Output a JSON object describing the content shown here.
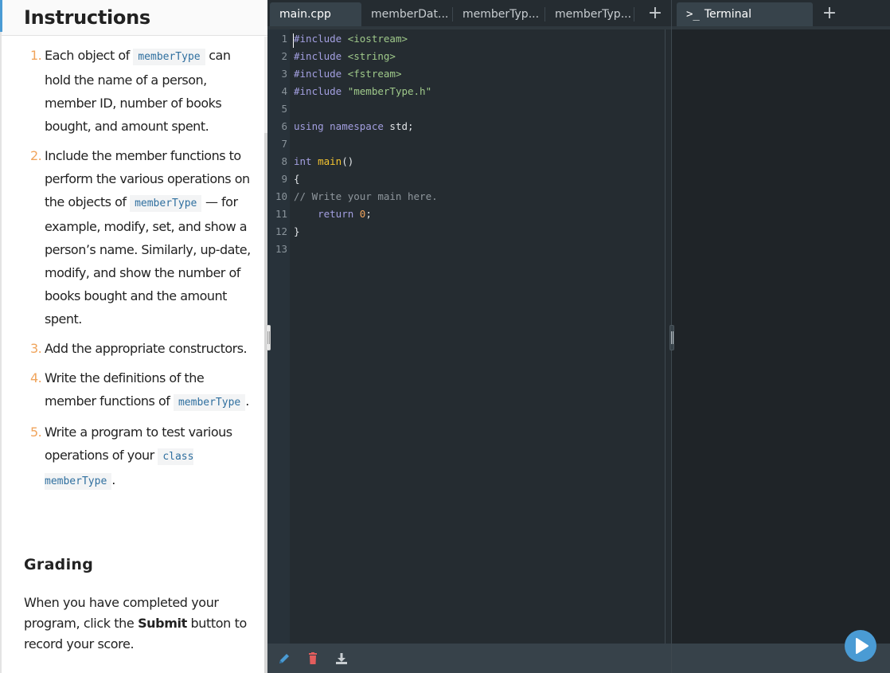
{
  "instructions": {
    "title": "Instructions",
    "items": [
      {
        "num": "1.",
        "before": "Each object of ",
        "code": "memberType",
        "after": " can hold the name of a person, member ID, number of books bought, and amount spent."
      },
      {
        "num": "2.",
        "before": "Include the member functions to perform the various operations on the objects of ",
        "code": "memberType",
        "after": " — for example, modify, set, and show a person’s name. Similarly, up-date, modify, and show the number of books bought and the amount spent."
      },
      {
        "num": "3.",
        "before": "Add the appropriate constructors.",
        "code": "",
        "after": ""
      },
      {
        "num": "4.",
        "before": "Write the definitions of the member functions of ",
        "code": "memberType",
        "after": "."
      },
      {
        "num": "5.",
        "before": "Write a program to test various operations of your ",
        "code": "class memberType",
        "after": "."
      }
    ],
    "grading_title": "Grading",
    "grading_before": "When you have completed your program, click the ",
    "grading_bold": "Submit",
    "grading_after": " button to record your score."
  },
  "editor": {
    "tabs": [
      {
        "label": "main.cpp",
        "active": true
      },
      {
        "label": "memberDat...",
        "active": false
      },
      {
        "label": "memberTyp...",
        "active": false
      },
      {
        "label": "memberTyp...",
        "active": false
      }
    ],
    "add_tab_label": "+",
    "lines": [
      {
        "n": "1",
        "tokens": [
          [
            "kw",
            "#include "
          ],
          [
            "str",
            "<iostream>"
          ]
        ]
      },
      {
        "n": "2",
        "tokens": [
          [
            "kw",
            "#include "
          ],
          [
            "str",
            "<string>"
          ]
        ]
      },
      {
        "n": "3",
        "tokens": [
          [
            "kw",
            "#include "
          ],
          [
            "str",
            "<fstream>"
          ]
        ]
      },
      {
        "n": "4",
        "tokens": [
          [
            "kw",
            "#include "
          ],
          [
            "str",
            "\"memberType.h\""
          ]
        ]
      },
      {
        "n": "5",
        "tokens": []
      },
      {
        "n": "6",
        "tokens": [
          [
            "kw",
            "using namespace "
          ],
          [
            "pl",
            "std;"
          ]
        ]
      },
      {
        "n": "7",
        "tokens": []
      },
      {
        "n": "8",
        "tokens": [
          [
            "kw",
            "int "
          ],
          [
            "fn",
            "main"
          ],
          [
            "pl",
            "()"
          ]
        ]
      },
      {
        "n": "9",
        "tokens": [
          [
            "pl",
            "{"
          ]
        ]
      },
      {
        "n": "10",
        "tokens": [
          [
            "cm",
            "// Write your main here."
          ]
        ]
      },
      {
        "n": "11",
        "tokens": [
          [
            "pl",
            "    "
          ],
          [
            "kw",
            "return "
          ],
          [
            "num",
            "0"
          ],
          [
            "pl",
            ";"
          ]
        ]
      },
      {
        "n": "12",
        "tokens": [
          [
            "pl",
            "}"
          ]
        ]
      },
      {
        "n": "13",
        "tokens": []
      }
    ],
    "footer_icons": [
      "pencil-icon",
      "trash-icon",
      "download-icon"
    ]
  },
  "terminal": {
    "tab_icon": ">_",
    "tab_label": "Terminal",
    "add_tab_label": "+"
  },
  "colors": {
    "accent": "#4a9bd4",
    "delete": "#e35d5d",
    "keyword": "#a39fe0",
    "string": "#9fc98a",
    "function": "#f4c430",
    "number": "#f0a45c"
  }
}
